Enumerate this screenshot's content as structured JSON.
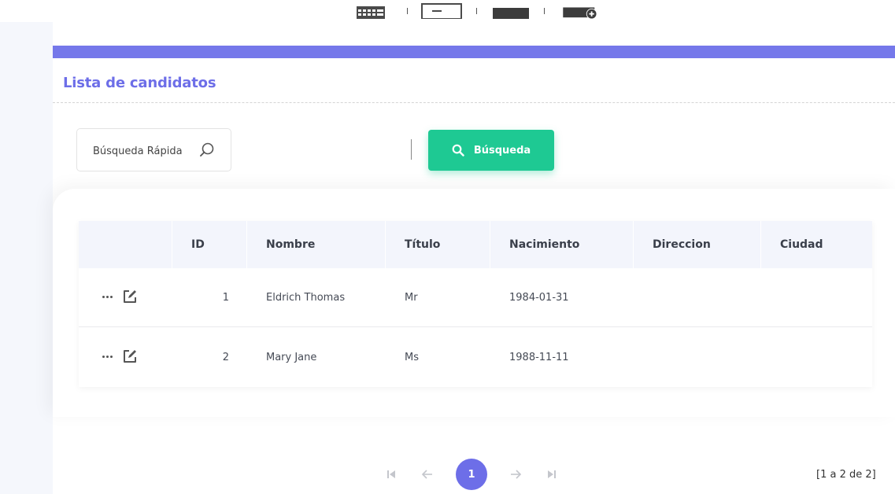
{
  "panel": {
    "title": "Lista de candidatos"
  },
  "search": {
    "quick_placeholder": "Búsqueda Rápida",
    "button_label": "Búsqueda"
  },
  "table": {
    "columns": [
      "",
      "ID",
      "Nombre",
      "Título",
      "Nacimiento",
      "Direccion",
      "Ciudad"
    ],
    "rows": [
      {
        "id": "1",
        "nombre": "Eldrich Thomas",
        "titulo": "Mr",
        "nacimiento": "1984-01-31",
        "direccion": "",
        "ciudad": ""
      },
      {
        "id": "2",
        "nombre": "Mary Jane",
        "titulo": "Ms",
        "nacimiento": "1988-11-11",
        "direccion": "",
        "ciudad": ""
      }
    ]
  },
  "pagination": {
    "current_page": "1",
    "range_text": "[1 a 2 de 2]"
  },
  "colors": {
    "accent": "#7578ea",
    "title": "#6d6ee8",
    "search_button": "#1ec993",
    "current_page": "#6d6ee8"
  },
  "icons": {
    "toolbar": [
      "calendar-grid-icon",
      "layout-icon",
      "folder-icon",
      "folder-add-icon"
    ],
    "row_actions": [
      "more-dots-icon",
      "edit-icon"
    ],
    "pager": [
      "first-page-icon",
      "prev-page-icon",
      "next-page-icon",
      "last-page-icon"
    ]
  }
}
